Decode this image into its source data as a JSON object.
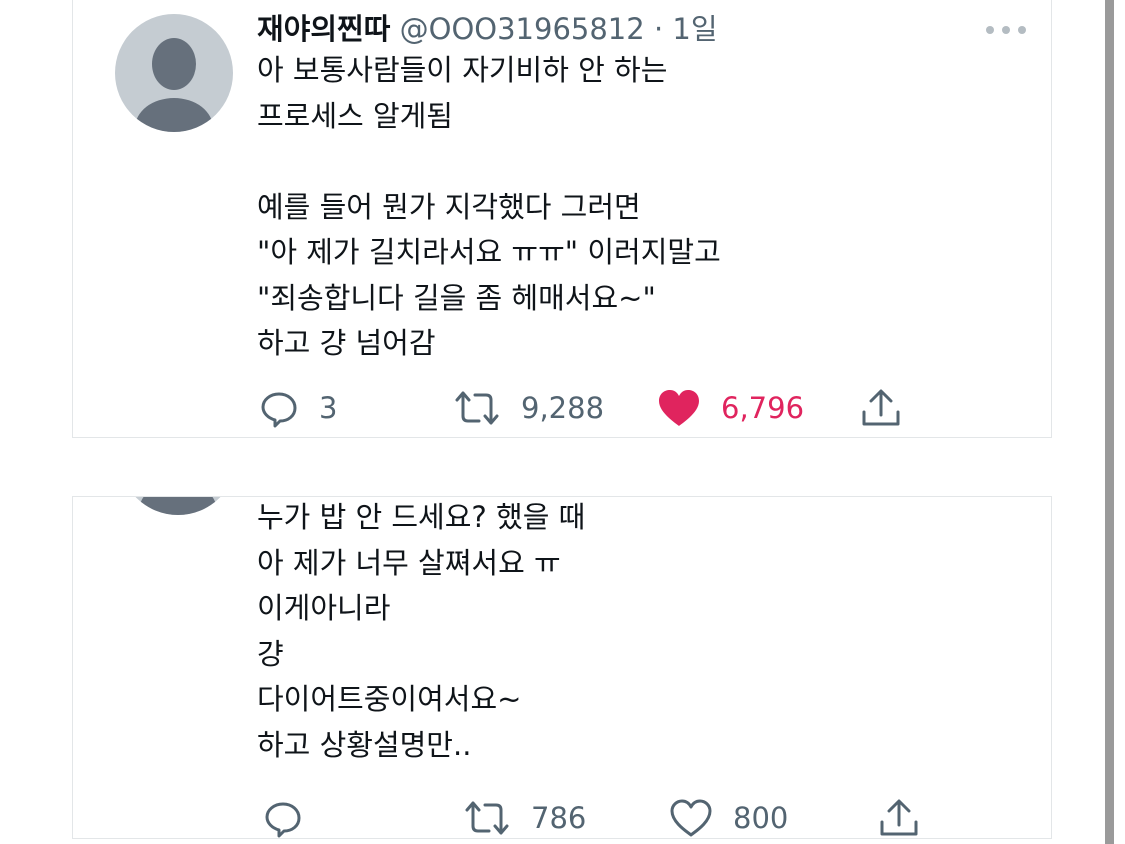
{
  "tweets": [
    {
      "display_name": "재야의찐따",
      "handle": "@OOO31965812",
      "separator": "·",
      "time": "1일",
      "text": "아 보통사람들이 자기비하 안 하는\n프로세스 알게됨\n\n예를 들어 뭔가 지각했다 그러면\n\"아 제가 길치라서요 ㅠㅠ\" 이러지말고\n\"죄송합니다 길을 좀 헤매서요~\"\n하고 걍 넘어감",
      "replies": "3",
      "retweets": "9,288",
      "likes": "6,796",
      "liked": true,
      "icons": [
        "avatar",
        "more-icon",
        "reply-icon",
        "retweet-icon",
        "heart-filled-icon",
        "share-icon"
      ]
    },
    {
      "text": "누가 밥 안 드세요? 했을 때\n아 제가 너무 살쪄서요 ㅠ\n이게아니라\n걍\n다이어트중이여서요~\n하고 상황설명만..",
      "replies": "",
      "retweets": "786",
      "likes": "800",
      "liked": false,
      "icons": [
        "avatar",
        "reply-icon",
        "retweet-icon",
        "heart-outline-icon",
        "share-icon"
      ]
    }
  ],
  "colors": {
    "text": "#0f1419",
    "secondary": "#536471",
    "like": "#e0245e",
    "avatar_bg": "#c5ccd2",
    "avatar_fg": "#66707c",
    "border": "#e3e6e8"
  }
}
